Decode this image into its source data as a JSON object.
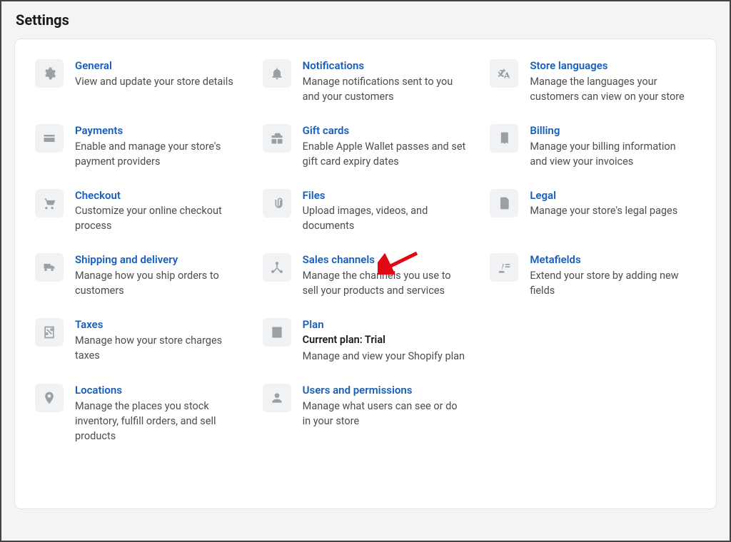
{
  "page": {
    "title": "Settings"
  },
  "annotation": {
    "arrow_target": "sales-channels"
  },
  "items": [
    {
      "key": "general",
      "title": "General",
      "desc": "View and update your store details"
    },
    {
      "key": "notifications",
      "title": "Notifications",
      "desc": "Manage notifications sent to you and your customers"
    },
    {
      "key": "store-languages",
      "title": "Store languages",
      "desc": "Manage the languages your customers can view on your store"
    },
    {
      "key": "payments",
      "title": "Payments",
      "desc": "Enable and manage your store's payment providers"
    },
    {
      "key": "gift-cards",
      "title": "Gift cards",
      "desc": "Enable Apple Wallet passes and set gift card expiry dates"
    },
    {
      "key": "billing",
      "title": "Billing",
      "desc": "Manage your billing information and view your invoices"
    },
    {
      "key": "checkout",
      "title": "Checkout",
      "desc": "Customize your online checkout process"
    },
    {
      "key": "files",
      "title": "Files",
      "desc": "Upload images, videos, and documents"
    },
    {
      "key": "legal",
      "title": "Legal",
      "desc": "Manage your store's legal pages"
    },
    {
      "key": "shipping",
      "title": "Shipping and delivery",
      "desc": "Manage how you ship orders to customers"
    },
    {
      "key": "sales-channels",
      "title": "Sales channels",
      "desc": "Manage the channels you use to sell your products and services"
    },
    {
      "key": "metafields",
      "title": "Metafields",
      "desc": "Extend your store by adding new fields"
    },
    {
      "key": "taxes",
      "title": "Taxes",
      "desc": "Manage how your store charges taxes"
    },
    {
      "key": "plan",
      "title": "Plan",
      "extra": "Current plan: Trial",
      "desc": "Manage and view your Shopify plan"
    },
    {
      "key": "blank1",
      "blank": true
    },
    {
      "key": "locations",
      "title": "Locations",
      "desc": "Manage the places you stock inventory, fulfill orders, and sell products"
    },
    {
      "key": "users",
      "title": "Users and permissions",
      "desc": "Manage what users can see or do in your store"
    },
    {
      "key": "blank2",
      "blank": true
    }
  ]
}
